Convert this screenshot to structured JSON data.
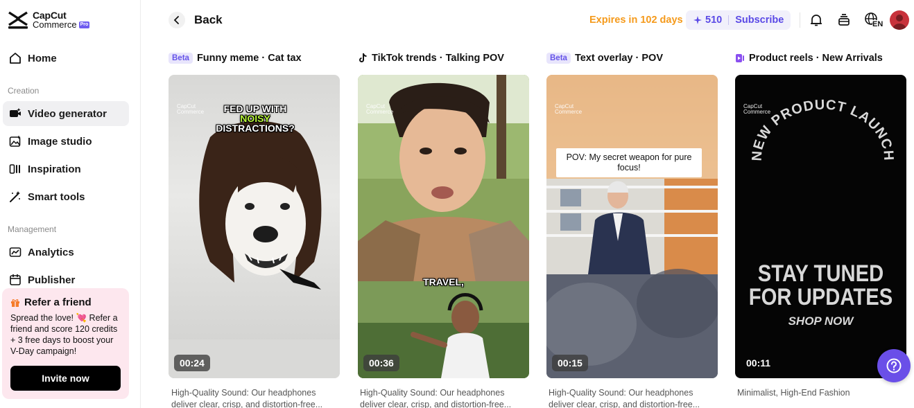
{
  "brand": {
    "line1": "CapCut",
    "line2": "Commerce",
    "badge": "Pro"
  },
  "sidebar": {
    "items": [
      {
        "label": "Home",
        "icon": "home-icon"
      },
      {
        "label": "Video generator",
        "icon": "video-generator-icon",
        "active": true
      },
      {
        "label": "Image studio",
        "icon": "image-studio-icon"
      },
      {
        "label": "Inspiration",
        "icon": "inspiration-icon"
      },
      {
        "label": "Smart tools",
        "icon": "magic-wand-icon"
      },
      {
        "label": "Analytics",
        "icon": "analytics-icon"
      },
      {
        "label": "Publisher",
        "icon": "calendar-icon"
      }
    ],
    "sections": {
      "creation": "Creation",
      "management": "Management"
    },
    "refer": {
      "title": "Refer a friend",
      "text": "Spread the love! 💘 Refer a friend and score 120 credits + 3 free days to boost your V-Day campaign!",
      "button": "Invite now"
    }
  },
  "header": {
    "back": "Back",
    "expires": "Expires in 102 days",
    "credits": "510",
    "subscribe": "Subscribe",
    "lang": "EN"
  },
  "cards": [
    {
      "badge": "Beta",
      "title": "Funny meme · Cat tax",
      "duration": "00:24",
      "caption_top": "FED UP WITH",
      "caption_hl": "NOISY",
      "caption_bottom": "DISTRACTIONS?",
      "desc": "High-Quality Sound: Our headphones deliver clear, crisp, and distortion-free..."
    },
    {
      "badge": "",
      "title": "TikTok trends · Talking POV",
      "duration": "00:36",
      "caption": "TRAVEL,",
      "desc": "High-Quality Sound: Our headphones deliver clear, crisp, and distortion-free..."
    },
    {
      "badge": "Beta",
      "title": "Text overlay · POV",
      "duration": "00:15",
      "caption": "POV: My secret weapon for pure focus!",
      "desc": "High-Quality Sound: Our headphones deliver clear, crisp, and distortion-free..."
    },
    {
      "badge": "",
      "title": "Product reels · New Arrivals",
      "duration": "00:11",
      "arc": "NEW PRODUCT LAUNCH",
      "line1": "STAY TUNED",
      "line2": "FOR UPDATES",
      "line3": "SHOP NOW",
      "desc": "Minimalist, High-End Fashion"
    }
  ],
  "watermark": {
    "line1": "CapCut",
    "line2": "Commerce"
  },
  "colors": {
    "accent": "#5a49e6",
    "expires": "#f59a1b",
    "refer_bg": "#fde7ee",
    "help": "#6a4fe8"
  }
}
